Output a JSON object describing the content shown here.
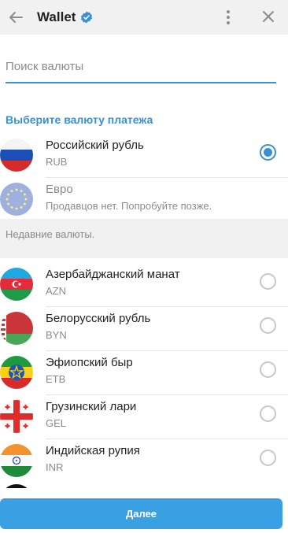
{
  "header": {
    "title": "Wallet",
    "back_icon": "arrow-left-icon",
    "verified_icon": "verified-badge-icon",
    "menu_icon": "more-vertical-icon",
    "close_icon": "close-icon"
  },
  "search": {
    "placeholder": "Поиск валюты",
    "value": ""
  },
  "section_title": "Выберите валюту платежа",
  "top_currencies": [
    {
      "name": "Российский рубль",
      "code": "RUB",
      "selected": true,
      "disabled": false,
      "flag": "russia-flag-icon"
    },
    {
      "name": "Евро",
      "note": "Продавцов нет. Попробуйте позже.",
      "selected": false,
      "disabled": true,
      "flag": "eu-flag-icon"
    }
  ],
  "recent_title": "Недавние валюты.",
  "recent_currencies": [
    {
      "name": "Азербайджанский манат",
      "code": "AZN",
      "selected": false,
      "flag": "azerbaijan-flag-icon"
    },
    {
      "name": "Белорусский рубль",
      "code": "BYN",
      "selected": false,
      "flag": "belarus-flag-icon"
    },
    {
      "name": "Эфиопский быр",
      "code": "ETB",
      "selected": false,
      "flag": "ethiopia-flag-icon"
    },
    {
      "name": "Грузинский лари",
      "code": "GEL",
      "selected": false,
      "flag": "georgia-flag-icon"
    },
    {
      "name": "Индийская рупия",
      "code": "INR",
      "selected": false,
      "flag": "india-flag-icon"
    }
  ],
  "footer": {
    "next_label": "Далее"
  },
  "colors": {
    "accent": "#3a8fd6",
    "button": "#3aa0e4",
    "header_bg": "#f1f1f1",
    "section_bg": "#f0f0f0"
  }
}
